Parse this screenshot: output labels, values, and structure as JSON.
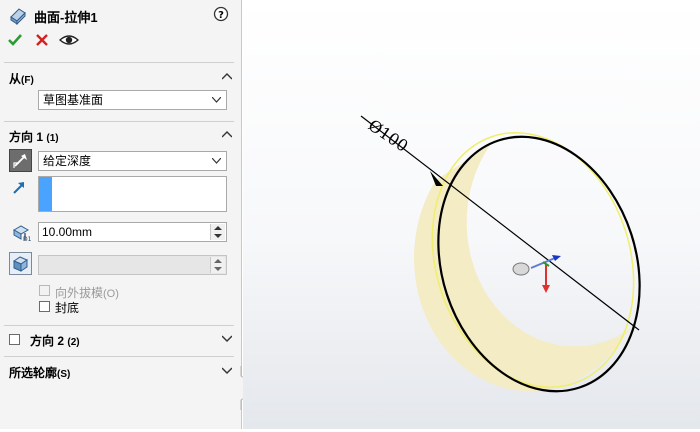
{
  "header": {
    "title": "曲面-拉伸1",
    "help_icon": "help-icon"
  },
  "actions": {
    "ok": "ok-icon",
    "cancel": "cancel-icon",
    "preview": "eye-icon"
  },
  "from_section": {
    "title": "从",
    "shortcut": "(F)",
    "value": "草图基准面"
  },
  "direction1": {
    "title": "方向 1",
    "shortcut": "(1)",
    "end_condition": "给定深度",
    "depth": "10.00mm",
    "draft_outward": "向外拔模",
    "draft_outward_shortcut": "(O)",
    "cap_ends": "封底"
  },
  "direction2": {
    "title": "方向 2",
    "shortcut": "(2)"
  },
  "selected_contours": {
    "title": "所选轮廓",
    "shortcut": "(S)"
  },
  "graphics": {
    "dimension": "Ø100"
  },
  "colors": {
    "accent": "#4aa3ff",
    "face": "#f4ecc4",
    "highlight": "#f0ee6a",
    "ok": "#2d9b35",
    "cancel": "#d42020"
  }
}
